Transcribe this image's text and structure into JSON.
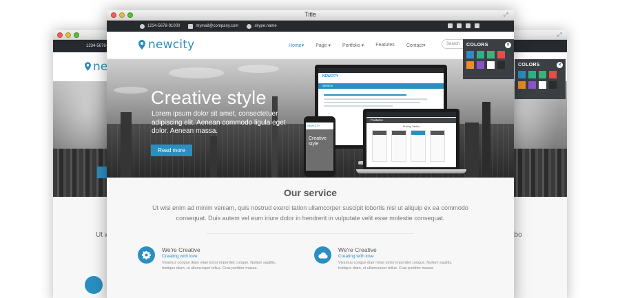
{
  "window": {
    "title": "Title"
  },
  "topbar": {
    "phone": "1234-5678-91000",
    "email": "mymail@company.com",
    "skype": "skype.name"
  },
  "brand": {
    "name": "newcity",
    "accent": "#2a8fc0"
  },
  "nav": {
    "items": [
      "Home",
      "Page",
      "Portfolio",
      "Features",
      "Contact"
    ],
    "active_index": 0
  },
  "search": {
    "placeholder": "Search"
  },
  "hero": {
    "title": "Creative style",
    "text": "Lorem ipsum dolor sit amet, consectetuer adipiscing elit. Aenean commodo ligula eget dolor. Aenean massa.",
    "button": "Read more"
  },
  "devices": {
    "monitor_logo": "NEWCITY",
    "monitor_band": "Service",
    "laptop_band": "Features",
    "laptop_heading": "Pricing Tables",
    "phone_logo": "NEWCITY",
    "phone_text": "Creative style"
  },
  "service": {
    "title": "Our service",
    "text": "Ut wisi enim ad minim veniam, quis nostrud exerci tation ullamcorper suscipit lobortis nisl ut aliquip ex ea commodo consequat. Duis autem vel eum iriure dolor in hendrerit in vulputate velit esse molestie consequat."
  },
  "features": [
    {
      "heading": "We're Creative",
      "sub": "Creating with love",
      "text": "Vivamus congue diam vitae tortor imperdiet congue. Nullam sagittis, tristique diam, ut ullamcorper tellus. Cras porttitor massa.",
      "icon": "gear-icon"
    },
    {
      "heading": "We're Creative",
      "sub": "Creating with love",
      "text": "Vivamus congue diam vitae tortor imperdiet congue. Nullam sagittis, tristique diam, ut ullamcorper tellus. Cras porttitor massa.",
      "icon": "cloud-icon"
    }
  ],
  "colors_panel": {
    "label": "COLORS",
    "swatches": [
      "#2a8fc0",
      "#2bb08a",
      "#3bb27a",
      "#e94b4b",
      "#e98c2b",
      "#8a53c9",
      "#ffffff",
      "#2c2c2c"
    ]
  },
  "background_windows": {
    "left_partial_text": "Ut w",
    "right_partial_text": "abo"
  }
}
